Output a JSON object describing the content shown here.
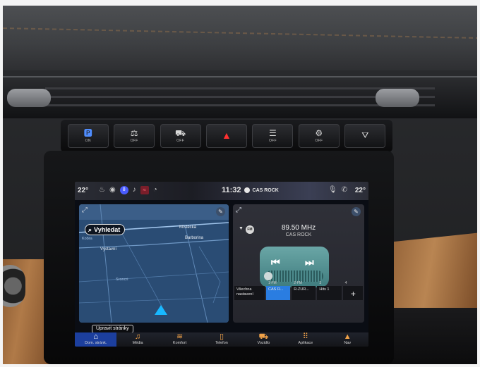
{
  "switches": [
    {
      "icon": "🅿",
      "label": "ON",
      "variant": "blue"
    },
    {
      "icon": "⚖",
      "label": "OFF",
      "variant": ""
    },
    {
      "icon": "⛟",
      "label": "OFF",
      "variant": ""
    },
    {
      "icon": "▲",
      "label": "",
      "variant": "hazard"
    },
    {
      "icon": "☰",
      "label": "OFF",
      "variant": ""
    },
    {
      "icon": "⚙",
      "label": "OFF",
      "variant": ""
    },
    {
      "icon": "⛛",
      "label": "",
      "variant": ""
    }
  ],
  "status_bar": {
    "temp_left": "22°",
    "time": "11:32",
    "station": "CAS ROCK",
    "temp_right": "22°"
  },
  "map": {
    "search_label": "Vyhledat",
    "labels": {
      "mistecka": "Místecká",
      "barborina": "Barborina",
      "kobra": "Kobra",
      "vystavni": "Výstavní",
      "sroncri": "Sroncri"
    }
  },
  "radio": {
    "band": "FM",
    "frequency": "89.50 MHz",
    "station": "CAS ROCK",
    "presets": [
      {
        "num": "",
        "label": "Všechna nastavení",
        "type": "all"
      },
      {
        "num": "1-FM",
        "label": "CAS R...",
        "type": "active"
      },
      {
        "num": "2-FM",
        "label": "R-ZUR...",
        "type": ""
      },
      {
        "num": "3",
        "label": "Hits 1",
        "type": ""
      },
      {
        "num": "4",
        "label": "+",
        "type": "add"
      }
    ]
  },
  "edit_pages_label": "Upravit stránky",
  "dock": [
    {
      "icon": "⌂",
      "label": "Dom. stránk.",
      "name": "home"
    },
    {
      "icon": "♫",
      "label": "Média",
      "name": "media"
    },
    {
      "icon": "≋",
      "label": "Komfort",
      "name": "comfort"
    },
    {
      "icon": "▯",
      "label": "Telefon",
      "name": "phone"
    },
    {
      "icon": "⛟",
      "label": "Vozidlo",
      "name": "vehicle"
    },
    {
      "icon": "⠿",
      "label": "Aplikace",
      "name": "apps"
    },
    {
      "icon": "▲",
      "label": "Nav",
      "name": "nav"
    }
  ]
}
